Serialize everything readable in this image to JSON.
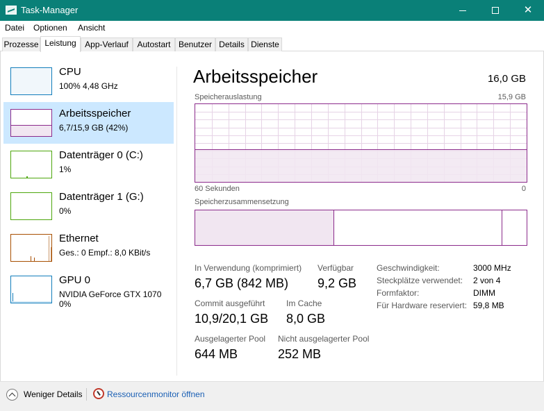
{
  "window": {
    "title": "Task-Manager",
    "icon": "task-manager-icon",
    "controls": [
      "minimize-icon",
      "maximize-icon",
      "close-icon"
    ]
  },
  "menu": [
    "Datei",
    "Optionen",
    "Ansicht"
  ],
  "tabs": [
    {
      "label": "Prozesse",
      "active": false
    },
    {
      "label": "Leistung",
      "active": true
    },
    {
      "label": "App-Verlauf",
      "active": false
    },
    {
      "label": "Autostart",
      "active": false
    },
    {
      "label": "Benutzer",
      "active": false
    },
    {
      "label": "Details",
      "active": false
    },
    {
      "label": "Dienste",
      "active": false
    }
  ],
  "sidebar": {
    "items": [
      {
        "name": "CPU",
        "line1": "100%  4,48 GHz",
        "line2": "",
        "color": "#117dbb",
        "selected": false
      },
      {
        "name": "Arbeitsspeicher",
        "line1": "6,7/15,9 GB (42%)",
        "line2": "",
        "color": "#8b2a8b",
        "selected": true
      },
      {
        "name": "Datenträger 0 (C:)",
        "line1": "1%",
        "line2": "",
        "color": "#4da60c",
        "selected": false
      },
      {
        "name": "Datenträger 1 (G:)",
        "line1": "0%",
        "line2": "",
        "color": "#4da60c",
        "selected": false
      },
      {
        "name": "Ethernet",
        "line1": "Ges.: 0  Empf.: 8,0 KBit/s",
        "line2": "",
        "color": "#a74f01",
        "selected": false
      },
      {
        "name": "GPU 0",
        "line1": "NVIDIA GeForce GTX 1070",
        "line2": "0%",
        "color": "#117dbb",
        "selected": false
      }
    ]
  },
  "main": {
    "title": "Arbeitsspeicher",
    "total": "16,0 GB",
    "usage_label": "Speicherauslastung",
    "usage_max": "15,9 GB",
    "usage_fraction": 0.42,
    "time_left": "60 Sekunden",
    "time_right": "0",
    "composition_label": "Speicherzusammensetzung",
    "composition": {
      "in_use_fraction": 0.42,
      "standby_end_fraction": 0.928
    },
    "stats": {
      "in_use_label": "In Verwendung (komprimiert)",
      "in_use_value": "6,7 GB (842 MB)",
      "available_label": "Verfügbar",
      "available_value": "9,2 GB",
      "commit_label": "Commit ausgeführt",
      "commit_value": "10,9/20,1 GB",
      "cache_label": "Im Cache",
      "cache_value": "8,0 GB",
      "paged_label": "Ausgelagerter Pool",
      "paged_value": "644 MB",
      "nonpaged_label": "Nicht ausgelagerter Pool",
      "nonpaged_value": "252 MB"
    },
    "details": [
      {
        "label": "Geschwindigkeit:",
        "value": "3000 MHz"
      },
      {
        "label": "Steckplätze verwendet:",
        "value": "2 von 4"
      },
      {
        "label": "Formfaktor:",
        "value": "DIMM"
      },
      {
        "label": "Für Hardware reserviert:",
        "value": "59,8 MB"
      }
    ]
  },
  "footer": {
    "fewer_details": "Weniger Details",
    "resource_monitor": "Ressourcenmonitor öffnen"
  },
  "colors": {
    "titlebar": "#0a8078",
    "memory": "#8b2a8b",
    "selection": "#cce8ff",
    "link": "#1a5fb4"
  }
}
